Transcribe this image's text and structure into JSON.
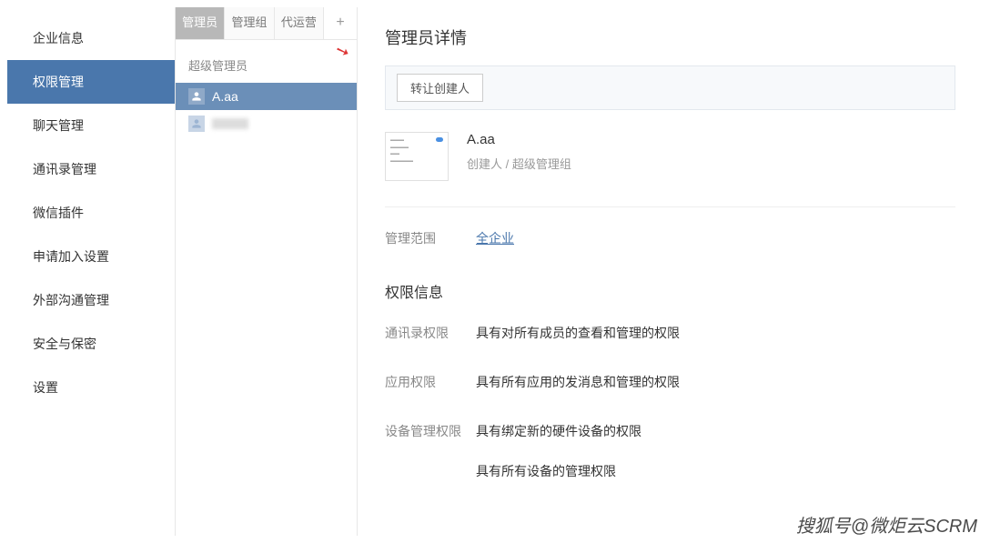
{
  "sidebar": {
    "items": [
      {
        "label": "企业信息"
      },
      {
        "label": "权限管理"
      },
      {
        "label": "聊天管理"
      },
      {
        "label": "通讯录管理"
      },
      {
        "label": "微信插件"
      },
      {
        "label": "申请加入设置"
      },
      {
        "label": "外部沟通管理"
      },
      {
        "label": "安全与保密"
      },
      {
        "label": "设置"
      }
    ],
    "active_index": 1
  },
  "mid": {
    "tabs": [
      {
        "label": "管理员"
      },
      {
        "label": "管理组"
      },
      {
        "label": "代运营"
      }
    ],
    "active_tab": 0,
    "plus_label": "+",
    "group_header": "超级管理员",
    "admins": [
      {
        "name": "A.aa",
        "selected": true
      },
      {
        "name": "",
        "selected": false,
        "blurred": true
      }
    ]
  },
  "detail": {
    "title": "管理员详情",
    "transfer_btn": "转让创建人",
    "profile": {
      "name": "A.aa",
      "role": "创建人 / 超级管理组"
    },
    "scope_label": "管理范围",
    "scope_value": "全企业",
    "perm_title": "权限信息",
    "rows": [
      {
        "label": "通讯录权限",
        "value": "具有对所有成员的查看和管理的权限"
      },
      {
        "label": "应用权限",
        "value": "具有所有应用的发消息和管理的权限"
      },
      {
        "label": "设备管理权限",
        "values": [
          "具有绑定新的硬件设备的权限",
          "具有所有设备的管理权限"
        ]
      }
    ]
  },
  "watermark": "搜狐号@微炬云SCRM"
}
